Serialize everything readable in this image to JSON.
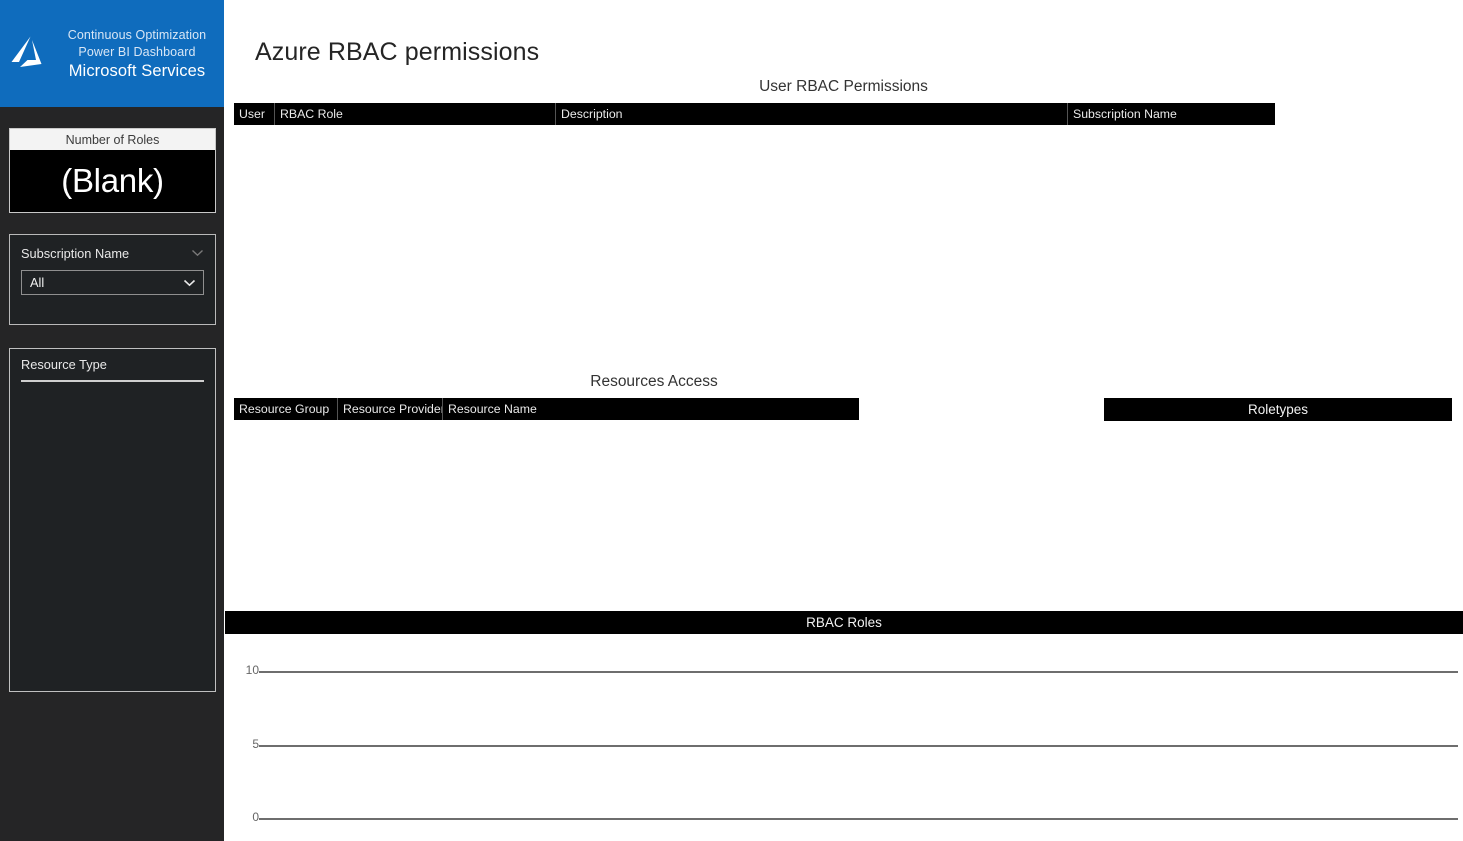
{
  "sidebar": {
    "brand": {
      "logo_icon": "azure-logo-icon",
      "line1": "Continuous Optimization",
      "line2": "Power BI Dashboard",
      "line3": "Microsoft Services",
      "background_color": "#0f6cbd"
    },
    "card_number_of_roles": {
      "title": "Number of Roles",
      "value": "(Blank)"
    },
    "slicer_subscription": {
      "label": "Subscription Name",
      "header_chevron_icon": "chevron-down-icon",
      "selected_value": "All",
      "dropdown_chevron_icon": "chevron-down-icon"
    },
    "slicer_resource_type": {
      "label": "Resource Type",
      "items": []
    }
  },
  "main": {
    "page_title": "Azure RBAC permissions",
    "user_permissions": {
      "title": "User RBAC Permissions",
      "columns": [
        "User",
        "RBAC Role",
        "Description",
        "Subscription Name"
      ],
      "rows": []
    },
    "resources_access": {
      "title": "Resources Access",
      "columns": [
        "Resource Group",
        "Resource Provider",
        "Resource Name"
      ],
      "rows": []
    },
    "roletypes": {
      "title": "Roletypes",
      "rows": []
    },
    "chart_data": {
      "type": "bar",
      "title": "RBAC Roles",
      "categories": [],
      "values": [],
      "xlabel": "",
      "ylabel": "",
      "ylim": [
        0,
        10
      ],
      "yticks": [
        "0",
        "5",
        "10"
      ],
      "grid": true,
      "legend": "none",
      "gridline_color": "#6e6e6e",
      "tick_label_color": "#666666"
    }
  }
}
